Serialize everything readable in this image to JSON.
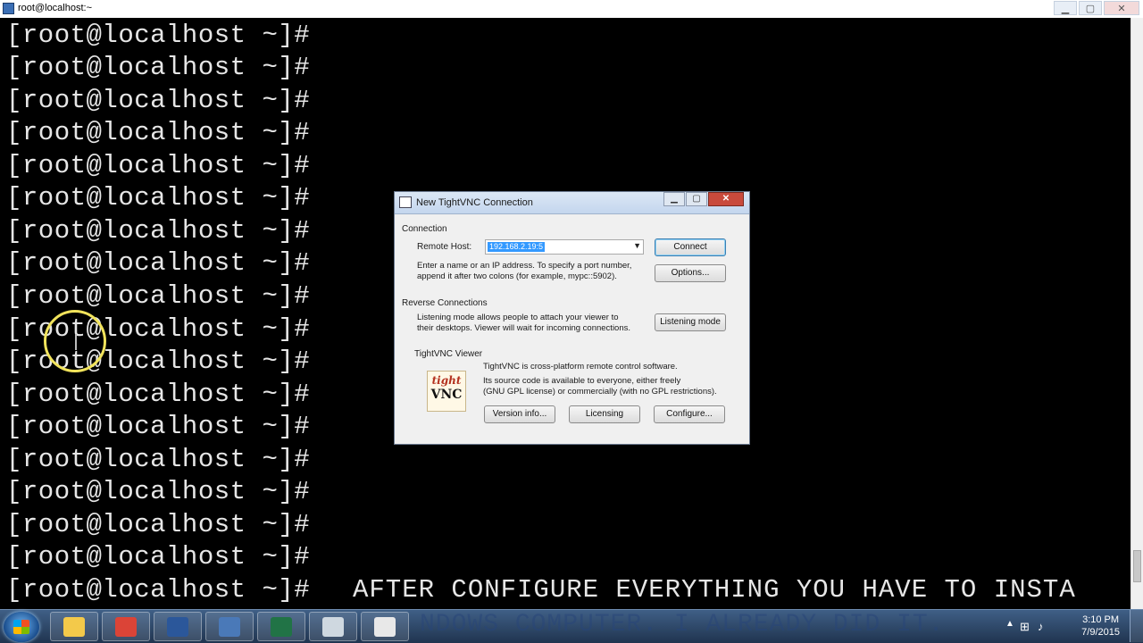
{
  "window": {
    "title": "root@localhost:~",
    "controls": {
      "minimize": "▁",
      "maximize": "▢",
      "close": "✕"
    }
  },
  "terminal": {
    "lines": [
      "[root@localhost ~]#",
      "[root@localhost ~]#",
      "[root@localhost ~]#",
      "[root@localhost ~]#",
      "[root@localhost ~]#",
      "[root@localhost ~]#",
      "[root@localhost ~]#",
      "[root@localhost ~]#",
      "[root@localhost ~]#",
      "[root@localhost ~]#",
      "[root@localhost ~]#",
      "[root@localhost ~]#",
      "[root@localhost ~]#",
      "[root@localhost ~]#",
      "[root@localhost ~]#",
      "[root@localhost ~]#",
      "[root@localhost ~]#",
      "[root@localhost ~]#"
    ],
    "caption": "AFTER CONFIGURE EVERYTHING YOU HAVE TO INSTA",
    "caption_continued": "NDOWS COMPUTER. I ALREADY DID IT."
  },
  "dialog": {
    "title": "New TightVNC Connection",
    "close_label": "✕",
    "connection": {
      "section": "Connection",
      "remote_host_label": "Remote Host:",
      "remote_host_value": "192.168.2.19:5",
      "hint_line1": "Enter a name or an IP address. To specify a port number,",
      "hint_line2": "append it after two colons (for example, mypc::5902).",
      "connect_button": "Connect",
      "options_button": "Options..."
    },
    "reverse": {
      "section": "Reverse Connections",
      "text_line1": "Listening mode allows people to attach your viewer to",
      "text_line2": "their desktops. Viewer will wait for incoming connections.",
      "listening_button": "Listening mode"
    },
    "viewer": {
      "section": "TightVNC Viewer",
      "logo_top": "tight",
      "logo_bottom": "VNC",
      "text_line1": "TightVNC is cross-platform remote control software.",
      "text_line2": "Its source code is available to everyone, either freely",
      "text_line3": "(GNU GPL license) or commercially (with no GPL restrictions).",
      "version_button": "Version info...",
      "licensing_button": "Licensing",
      "configure_button": "Configure..."
    }
  },
  "taskbar": {
    "items": [
      {
        "name": "explorer",
        "color": "#f3c94a"
      },
      {
        "name": "chrome",
        "color": "#db4437"
      },
      {
        "name": "word",
        "color": "#2b579a"
      },
      {
        "name": "putty",
        "color": "#4a79b8"
      },
      {
        "name": "excel",
        "color": "#217346"
      },
      {
        "name": "snipping-tool",
        "color": "#cfd8e0"
      },
      {
        "name": "tightvnc",
        "color": "#e8e8e8"
      }
    ],
    "clock_time": "3:10 PM",
    "clock_date": "7/9/2015"
  }
}
